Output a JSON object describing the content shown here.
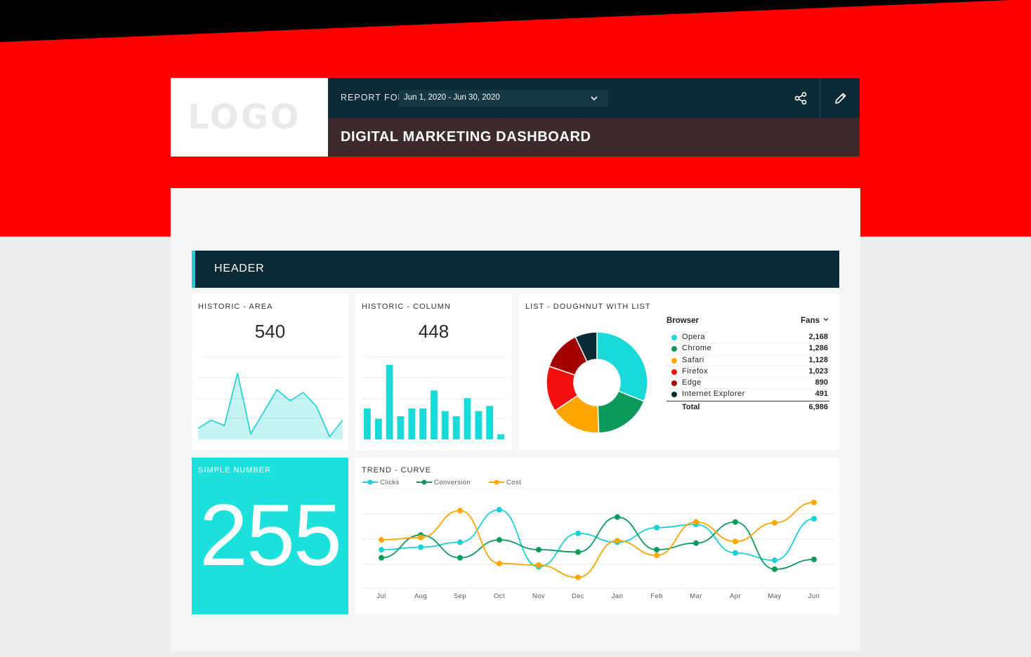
{
  "header": {
    "logo": "LOGO",
    "report_for_label": "REPORT FOR",
    "date_range": "Jun 1, 2020 - Jun 30, 2020",
    "title": "DIGITAL MARKETING DASHBOARD"
  },
  "section": {
    "title": "HEADER"
  },
  "widgets": {
    "historic_area": {
      "title": "HISTORIC - AREA",
      "value": "540"
    },
    "historic_column": {
      "title": "HISTORIC - COLUMN",
      "value": "448"
    },
    "doughnut": {
      "title": "LIST - DOUGHNUT WITH LIST",
      "col_browser": "Browser",
      "col_fans": "Fans",
      "rows": [
        {
          "label": "Opera",
          "value": "2,168",
          "color": "#1ad9d9"
        },
        {
          "label": "Chrome",
          "value": "1,286",
          "color": "#0c9a5c"
        },
        {
          "label": "Safari",
          "value": "1,128",
          "color": "#ffa500"
        },
        {
          "label": "Firefox",
          "value": "1,023",
          "color": "#f20f0f"
        },
        {
          "label": "Edge",
          "value": "890",
          "color": "#a30000"
        },
        {
          "label": "Internet Explorer",
          "value": "491",
          "color": "#0c2a35"
        }
      ],
      "total_label": "Total",
      "total_value": "6,986"
    },
    "simple_number": {
      "title": "SIMPLE NUMBER",
      "value": "255"
    },
    "trend": {
      "title": "TREND - CURVE",
      "legend": [
        "Clicks",
        "Conversion",
        "Cost"
      ],
      "months": [
        "Jul",
        "Aug",
        "Sep",
        "Oct",
        "Nov",
        "Dec",
        "Jan",
        "Feb",
        "Mar",
        "Apr",
        "May",
        "Jun"
      ]
    }
  },
  "chart_data": [
    {
      "type": "area",
      "title": "HISTORIC - AREA",
      "values": [
        4,
        7,
        5,
        24,
        2,
        10,
        18,
        14,
        17,
        12,
        1,
        7
      ],
      "ylim": [
        0,
        30
      ],
      "color": "#1ad0d3"
    },
    {
      "type": "bar",
      "title": "HISTORIC - COLUMN",
      "values": [
        12,
        8,
        29,
        9,
        12,
        12,
        19,
        11,
        9,
        16,
        11,
        13,
        2
      ],
      "ylim": [
        0,
        30
      ],
      "color": "#1ad9d9"
    },
    {
      "type": "pie",
      "title": "LIST - DOUGHNUT WITH LIST",
      "categories": [
        "Opera",
        "Chrome",
        "Safari",
        "Firefox",
        "Edge",
        "Internet Explorer"
      ],
      "values": [
        2168,
        1286,
        1128,
        1023,
        890,
        491
      ],
      "colors": [
        "#1ad9d9",
        "#0c9a5c",
        "#ffa500",
        "#f20f0f",
        "#a30000",
        "#0c2a35"
      ]
    },
    {
      "type": "line",
      "title": "TREND - CURVE",
      "categories": [
        "Jul",
        "Aug",
        "Sep",
        "Oct",
        "Nov",
        "Dec",
        "Jan",
        "Feb",
        "Mar",
        "Apr",
        "May",
        "Jun"
      ],
      "ylim": [
        0,
        100
      ],
      "series": [
        {
          "name": "Clicks",
          "color": "#1ad0d3",
          "values": [
            37,
            40,
            46,
            86,
            16,
            57,
            46,
            64,
            68,
            33,
            24,
            75
          ]
        },
        {
          "name": "Conversion",
          "color": "#0c9a5c",
          "values": [
            27,
            55,
            27,
            49,
            37,
            34,
            77,
            37,
            45,
            71,
            13,
            25
          ]
        },
        {
          "name": "Cost",
          "color": "#ffa500",
          "values": [
            49,
            52,
            85,
            20,
            18,
            3,
            48,
            30,
            71,
            47,
            70,
            95
          ]
        }
      ]
    }
  ]
}
